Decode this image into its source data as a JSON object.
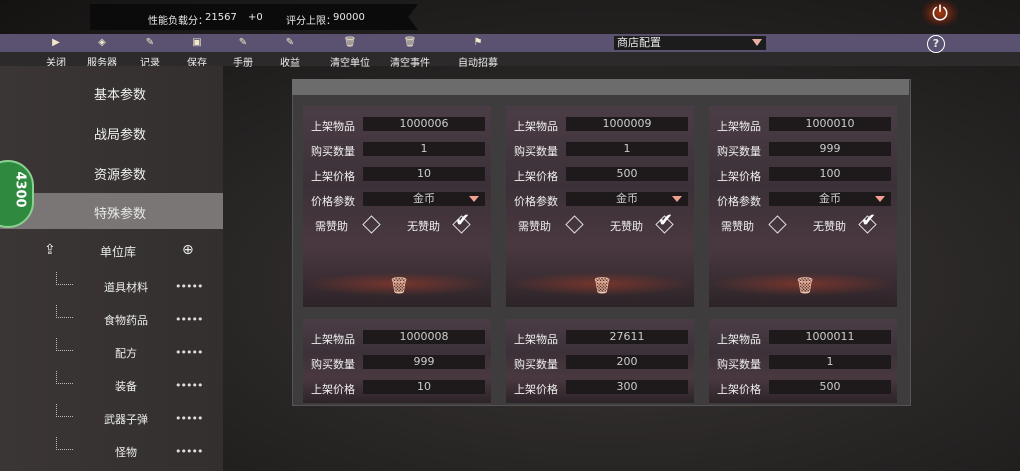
{
  "stats": {
    "score_label": "性能负载分：",
    "score": "21567",
    "delta": "+0",
    "limit_label": "评分上限：",
    "limit": "90000"
  },
  "power_icon": "power-icon",
  "toolbar": [
    {
      "label": "关闭",
      "icon": "play-icon"
    },
    {
      "label": "服务器",
      "icon": "cube-icon"
    },
    {
      "label": "记录",
      "icon": "edit-icon"
    },
    {
      "label": "保存",
      "icon": "save-icon"
    },
    {
      "label": "手册",
      "icon": "edit-icon"
    },
    {
      "label": "收益",
      "icon": "edit-icon"
    },
    {
      "label": "清空单位",
      "icon": "trash-icon"
    },
    {
      "label": "清空事件",
      "icon": "trash-icon"
    },
    {
      "label": "自动招募",
      "icon": "flag-icon"
    }
  ],
  "shop_select": "商店配置",
  "help": "?",
  "nav": {
    "basic": "基本参数",
    "battle": "战局参数",
    "resource": "资源参数",
    "special": "特殊参数"
  },
  "bubble_text": "4300",
  "unit_lib": {
    "title": "单位库",
    "items": [
      {
        "label": "道具材料",
        "dots": "•••••"
      },
      {
        "label": "食物药品",
        "dots": "•••••"
      },
      {
        "label": "配方",
        "dots": "•••••"
      },
      {
        "label": "装备",
        "dots": "•••••"
      },
      {
        "label": "武器子弹",
        "dots": "•••••"
      },
      {
        "label": "怪物",
        "dots": "•••••"
      }
    ]
  },
  "labels": {
    "item": "上架物品",
    "qty": "购买数量",
    "price": "上架价格",
    "param": "价格参数",
    "need": "需赞助",
    "noneed": "无赞助"
  },
  "cards": [
    {
      "item": "1000006",
      "qty": "1",
      "price": "10",
      "param": "金币"
    },
    {
      "item": "1000009",
      "qty": "1",
      "price": "500",
      "param": "金币"
    },
    {
      "item": "1000010",
      "qty": "999",
      "price": "100",
      "param": "金币"
    },
    {
      "item": "1000008",
      "qty": "999",
      "price": "10"
    },
    {
      "item": "27611",
      "qty": "200",
      "price": "300"
    },
    {
      "item": "1000011",
      "qty": "1",
      "price": "500"
    }
  ],
  "colors": {
    "toolbar": "#5a5270",
    "selected_nav": "#7a7675",
    "card_bg": "#3c3138",
    "accent": "#f0a090"
  }
}
